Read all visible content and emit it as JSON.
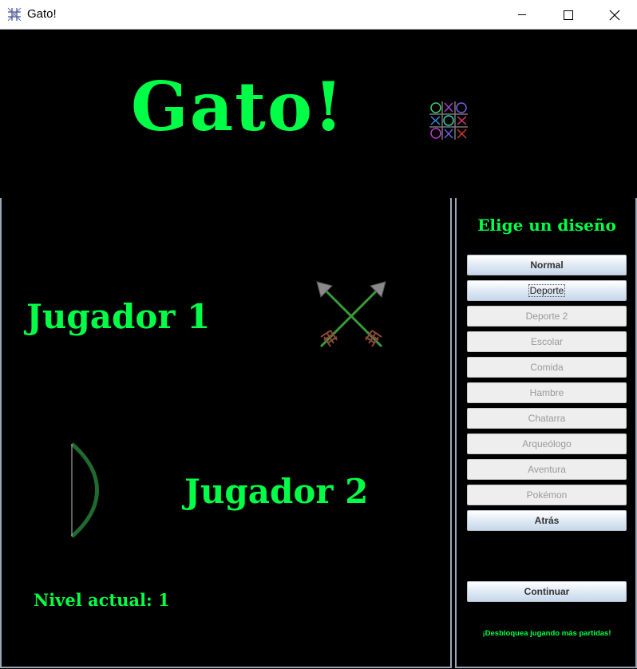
{
  "window": {
    "title": "Gato!",
    "icon": "tic-tac-toe-icon"
  },
  "header": {
    "title": "Gato!",
    "icon": "tic-tac-toe-board-icon",
    "title_color": "#00ff47"
  },
  "game": {
    "player1_label": "Jugador 1",
    "player2_label": "Jugador 2",
    "player1_icon": "crossed-arrows-icon",
    "player2_icon": "bow-icon",
    "level_text": "Nivel actual: 1"
  },
  "design_panel": {
    "heading": "Elige un diseño",
    "options": [
      {
        "label": "Normal",
        "enabled": true
      },
      {
        "label": "Deporte",
        "enabled": true,
        "focused": true
      },
      {
        "label": "Deporte 2",
        "enabled": false
      },
      {
        "label": "Escolar",
        "enabled": false
      },
      {
        "label": "Comida",
        "enabled": false
      },
      {
        "label": "Hambre",
        "enabled": false
      },
      {
        "label": "Chatarra",
        "enabled": false
      },
      {
        "label": "Arqueólogo",
        "enabled": false
      },
      {
        "label": "Aventura",
        "enabled": false
      },
      {
        "label": "Pokémon",
        "enabled": false
      },
      {
        "label": "Atrás",
        "enabled": true
      }
    ],
    "continue_label": "Continuar",
    "unlock_hint": "¡Desbloquea jugando más partidas!"
  },
  "colors": {
    "accent": "#00ff47",
    "background": "#000000",
    "panel_border": "#9aa6b8"
  }
}
